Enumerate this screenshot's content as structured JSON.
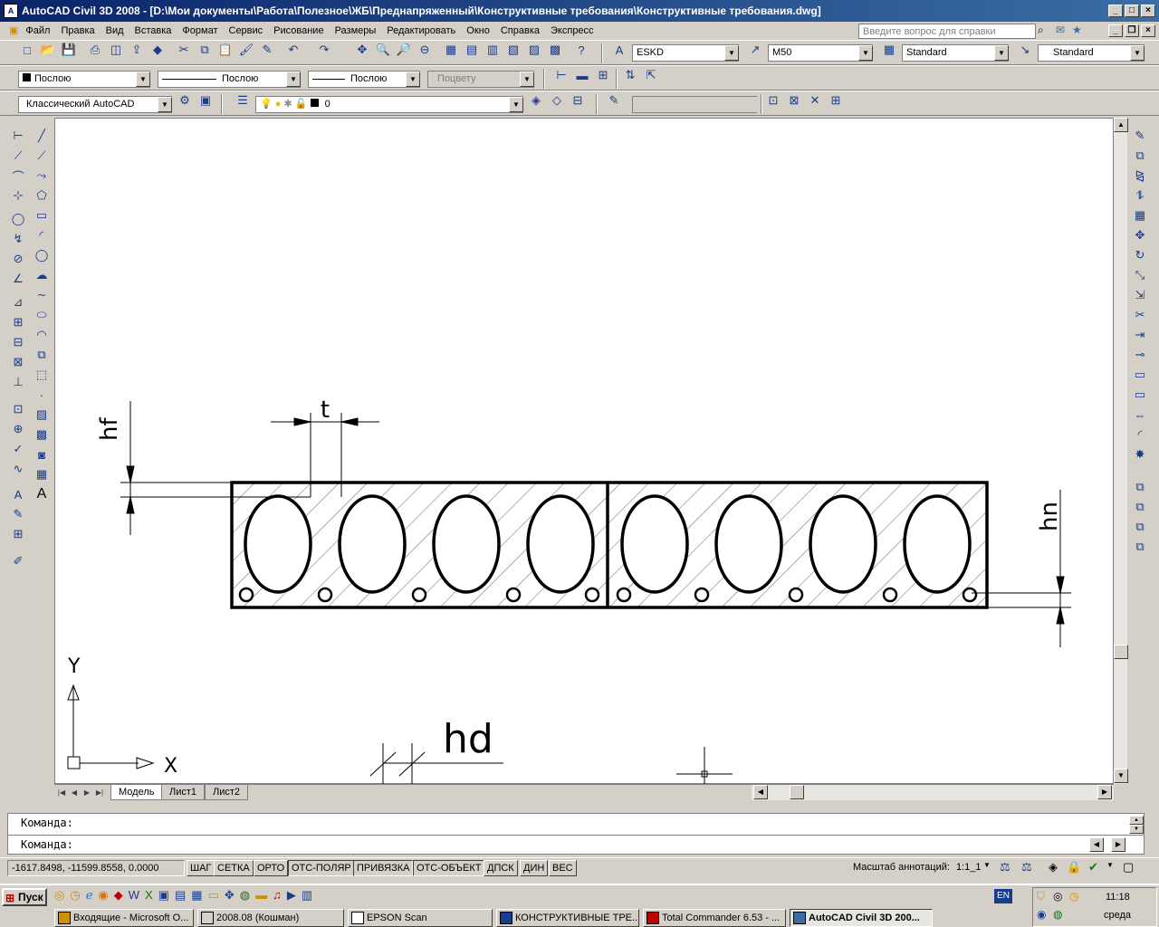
{
  "window": {
    "title": "AutoCAD Civil 3D 2008 - [D:\\Мои документы\\Работа\\Полезное\\ЖБ\\Преднапряженный\\Конструктивные требования\\Конструктивные требования.dwg]"
  },
  "menu": [
    "Файл",
    "Правка",
    "Вид",
    "Вставка",
    "Формат",
    "Сервис",
    "Рисование",
    "Размеры",
    "Редактировать",
    "Окно",
    "Справка",
    "Экспресс"
  ],
  "help": {
    "placeholder": "Введите вопрос для справки"
  },
  "toolbar": {
    "text_style": "ESKD",
    "dim_style": "M50",
    "table_style": "Standard",
    "mleader_style": "Standard",
    "color": "Послою",
    "linetype": "Послою",
    "lineweight": "Послою",
    "plot_style": "Поцвету",
    "workspace": "Классический AutoCAD",
    "layer": "0"
  },
  "drawing": {
    "labels": {
      "hf": "hf",
      "t": "t",
      "hn": "hn",
      "hd": "hd",
      "axis_x": "X",
      "axis_y": "Y"
    }
  },
  "layout_tabs": [
    "Модель",
    "Лист1",
    "Лист2"
  ],
  "command": {
    "line1": "Команда:",
    "line2": "Команда:"
  },
  "status": {
    "coords": "-1617.8498, -11599.8558, 0.0000",
    "buttons": [
      "ШАГ",
      "СЕТКА",
      "ОРТО",
      "ОТС-ПОЛЯР",
      "ПРИВЯЗКА",
      "ОТС-ОБЪЕКТ",
      "ДПСК",
      "ДИН",
      "ВЕС"
    ],
    "annotation_scale_label": "Масштаб аннотаций:",
    "annotation_scale": "1:1_1"
  },
  "taskbar": {
    "start": "Пуск",
    "tasks": [
      "Входящие - Microsoft O...",
      "2008.08 (Кошман)",
      "EPSON Scan",
      "КОНСТРУКТИВНЫЕ ТРЕ...",
      "Total Commander 6.53 - ...",
      "AutoCAD Civil 3D 200..."
    ],
    "lang": "EN",
    "time": "11:18",
    "day": "среда"
  }
}
